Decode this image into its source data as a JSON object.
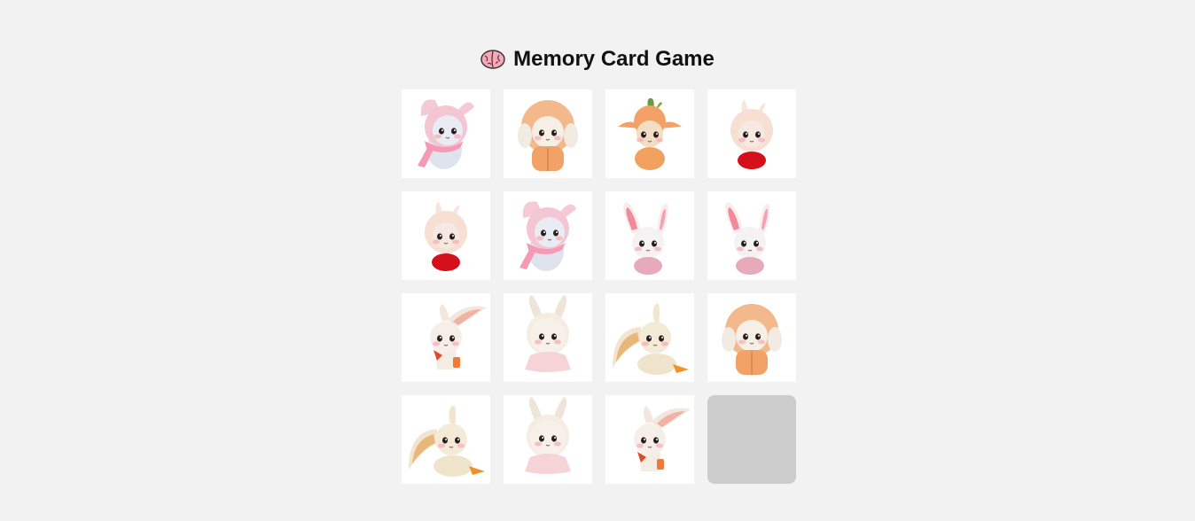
{
  "title": {
    "emoji_icon": "brain-icon",
    "text": "Memory Card Game"
  },
  "board": {
    "columns": 4,
    "cards": [
      {
        "state": "revealed",
        "icon": "bunny-pink-hood-scarf-icon",
        "variant": "scarf"
      },
      {
        "state": "revealed",
        "icon": "bunny-orange-sweater-icon",
        "variant": "sweater"
      },
      {
        "state": "revealed",
        "icon": "bunny-carrot-hat-icon",
        "variant": "carrot"
      },
      {
        "state": "revealed",
        "icon": "bunny-fluffy-red-icon",
        "variant": "fluffy"
      },
      {
        "state": "revealed",
        "icon": "bunny-fluffy-red-icon",
        "variant": "fluffy"
      },
      {
        "state": "revealed",
        "icon": "bunny-pink-hood-scarf-icon",
        "variant": "scarf"
      },
      {
        "state": "revealed",
        "icon": "bunny-pink-ears-icon",
        "variant": "pinkears"
      },
      {
        "state": "revealed",
        "icon": "bunny-pink-ears-icon",
        "variant": "pinkears"
      },
      {
        "state": "revealed",
        "icon": "bunny-red-bow-icon",
        "variant": "redbow"
      },
      {
        "state": "revealed",
        "icon": "bunny-tutu-icon",
        "variant": "tutu"
      },
      {
        "state": "revealed",
        "icon": "bunny-sitting-carrot-icon",
        "variant": "sitcarrot"
      },
      {
        "state": "revealed",
        "icon": "bunny-orange-sweater-icon",
        "variant": "sweater"
      },
      {
        "state": "revealed",
        "icon": "bunny-sitting-carrot-icon",
        "variant": "sitcarrot"
      },
      {
        "state": "revealed",
        "icon": "bunny-tutu-icon",
        "variant": "tutu"
      },
      {
        "state": "revealed",
        "icon": "bunny-red-bow-icon",
        "variant": "redbow"
      },
      {
        "state": "hidden",
        "icon": "card-back-icon",
        "variant": "back"
      }
    ]
  },
  "colors": {
    "background": "#f2f2f2",
    "card_face": "#ffffff",
    "card_back": "#cccccc",
    "title_text": "#111111"
  }
}
